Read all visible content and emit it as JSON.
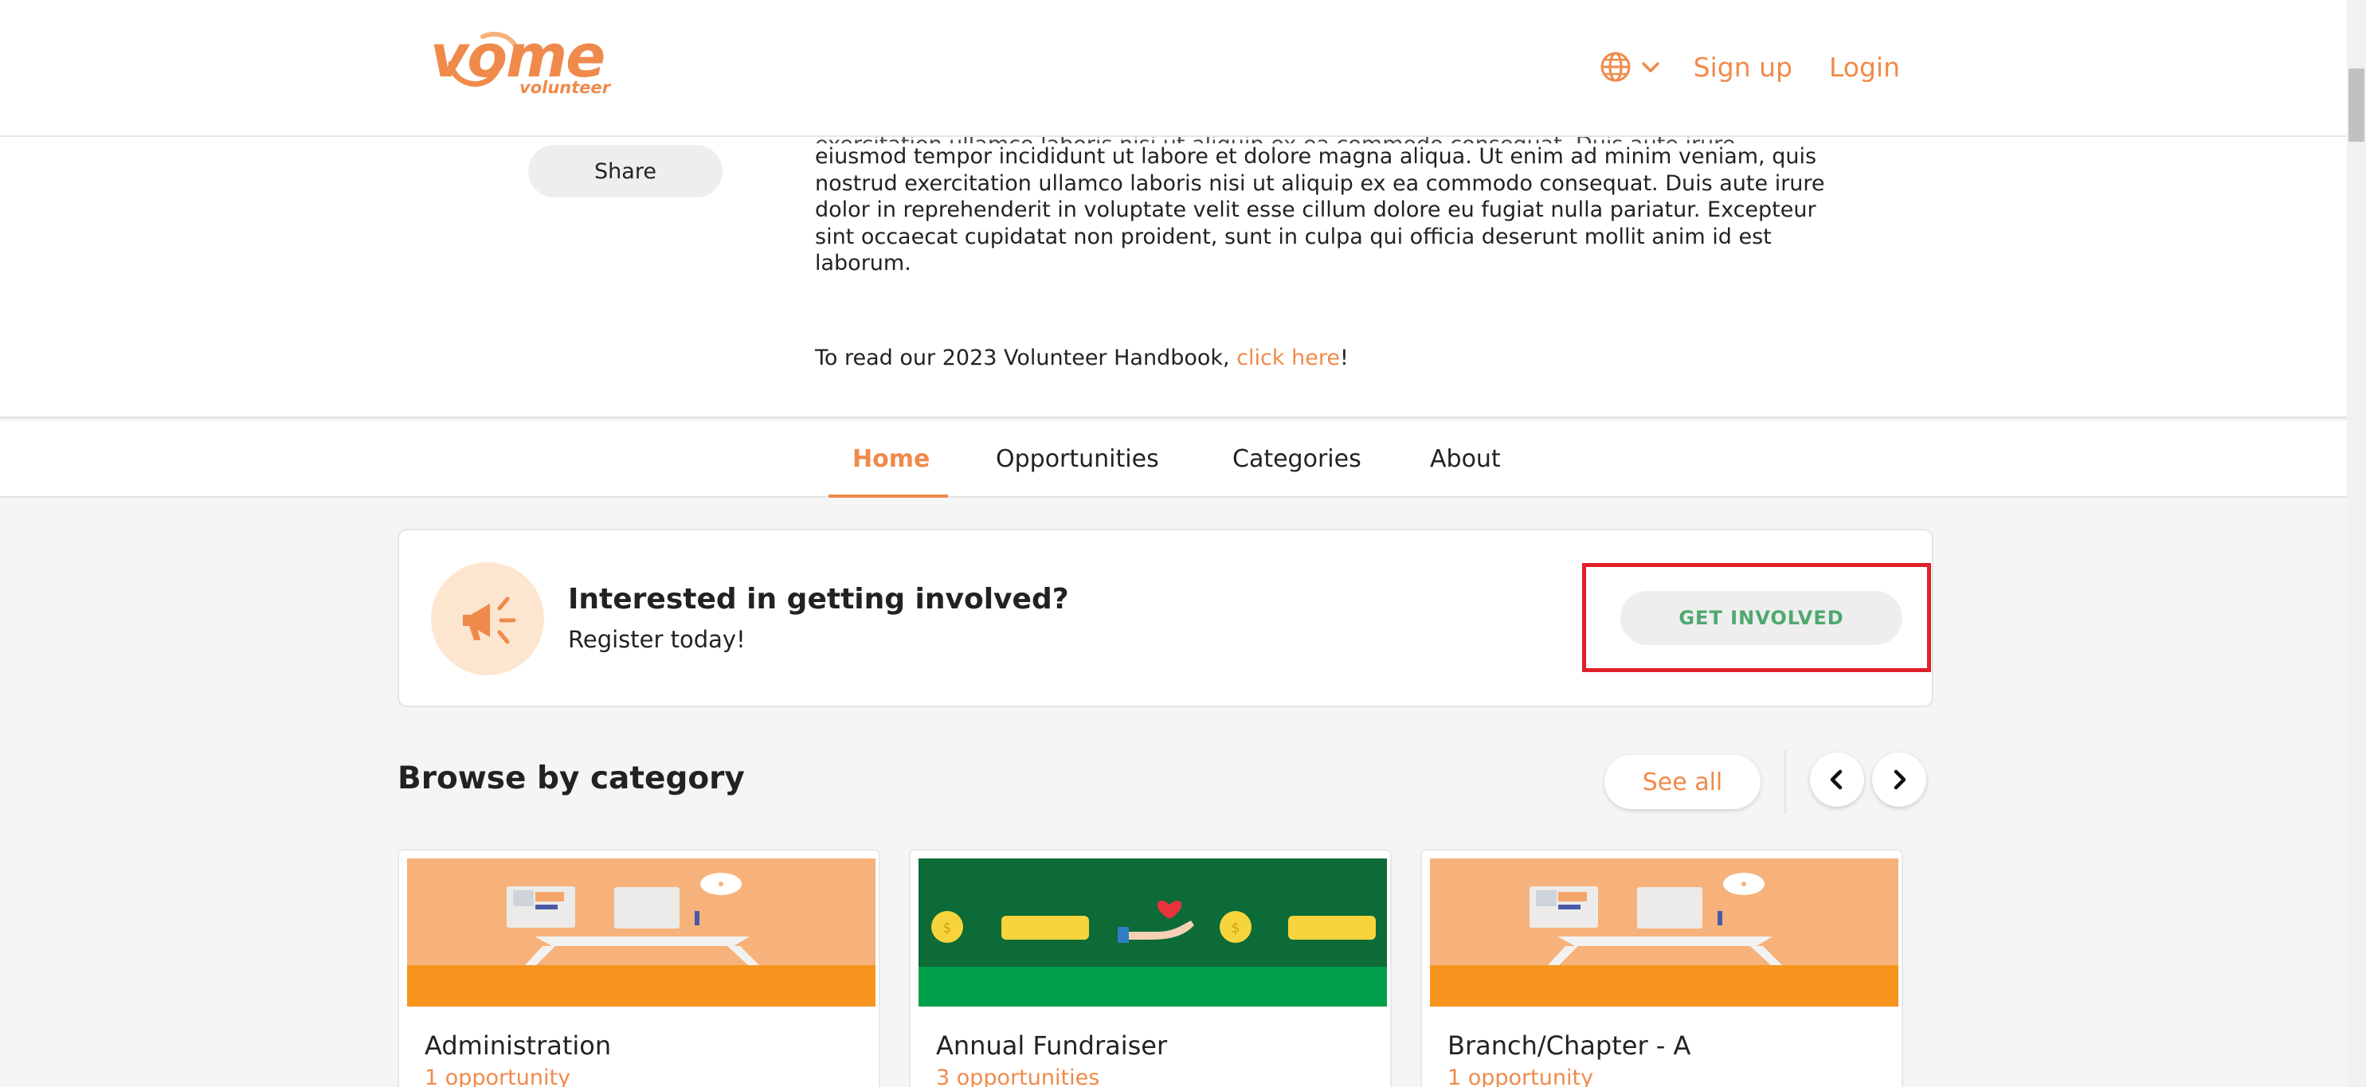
{
  "header": {
    "logo_main": "vome",
    "logo_sub": "volunteer",
    "language_icon": "globe-icon",
    "signup_label": "Sign up",
    "login_label": "Login"
  },
  "description": {
    "share_label": "Share",
    "clipped_line": "exercitation ullamco laboris nisi ut aliquip ex ea commodo consequat. Duis aute irure",
    "paragraph": "eiusmod tempor incididunt ut labore et dolore magna aliqua. Ut enim ad minim veniam, quis nostrud exercitation ullamco laboris nisi ut aliquip ex ea commodo consequat. Duis aute irure dolor in reprehenderit in voluptate velit esse cillum dolore eu fugiat nulla pariatur. Excepteur sint occaecat cupidatat non proident, sunt in culpa qui officia deserunt mollit anim id est laborum.",
    "handbook_prefix": "To read our 2023 Volunteer Handbook, ",
    "handbook_link": "click here",
    "handbook_suffix": "!"
  },
  "tabs": [
    {
      "label": "Home",
      "active": true
    },
    {
      "label": "Opportunities",
      "active": false
    },
    {
      "label": "Categories",
      "active": false
    },
    {
      "label": "About",
      "active": false
    }
  ],
  "involve": {
    "icon": "megaphone-icon",
    "title": "Interested in getting involved?",
    "subtitle": "Register today!",
    "button_label": "GET INVOLVED"
  },
  "browse": {
    "title": "Browse by category",
    "see_all_label": "See all",
    "prev_icon": "chevron-left-icon",
    "next_icon": "chevron-right-icon",
    "categories": [
      {
        "name": "Administration",
        "count": "1 opportunity"
      },
      {
        "name": "Annual Fundraiser",
        "count": "3 opportunities"
      },
      {
        "name": "Branch/Chapter - A",
        "count": "1 opportunity"
      }
    ]
  },
  "colors": {
    "brand": "#f08a4b",
    "accent_green": "#4fa870",
    "highlight_red": "#e0202a",
    "desk_orange": "#f6b27a",
    "fundraiser_green": "#0c6b37"
  }
}
